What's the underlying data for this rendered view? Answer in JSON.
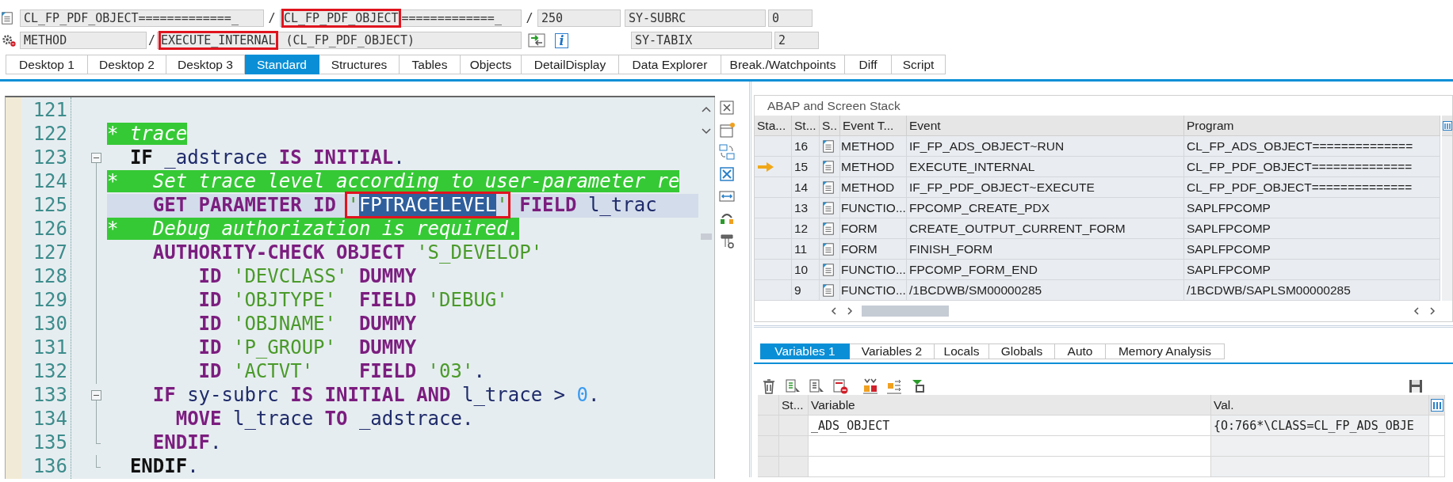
{
  "program_bar": {
    "include": "CL_FP_PDF_OBJECT=============_",
    "separators": [
      "/",
      "/"
    ],
    "main_program": [
      {
        "text": "CL_FP_PDF_OBJECT",
        "marked": true
      },
      {
        "text": "=============_",
        "marked": false
      }
    ],
    "line": "250",
    "sysvar_name": "SY-SUBRC",
    "sysvar_value": "0"
  },
  "event_bar": {
    "event_type": "METHOD",
    "separator": "/",
    "event": [
      {
        "text": "EXECUTE_INTERNAL",
        "marked": true
      },
      {
        "text": " (CL_FP_PDF_OBJECT)",
        "marked": false
      }
    ],
    "info_button": "i",
    "sysvar_name": "SY-TABIX",
    "sysvar_value": "2"
  },
  "tabs": [
    {
      "label": "Desktop 1",
      "selected": false
    },
    {
      "label": "Desktop 2",
      "selected": false
    },
    {
      "label": "Desktop 3",
      "selected": false
    },
    {
      "label": "Standard",
      "selected": true
    },
    {
      "label": "Structures",
      "selected": false
    },
    {
      "label": "Tables",
      "selected": false
    },
    {
      "label": "Objects",
      "selected": false
    },
    {
      "label": "DetailDisplay",
      "selected": false
    },
    {
      "label": "Data Explorer",
      "selected": false
    },
    {
      "label": "Break./Watchpoints",
      "selected": false
    },
    {
      "label": "Diff",
      "selected": false
    },
    {
      "label": "Script",
      "selected": false
    }
  ],
  "code_editor": {
    "lines": [
      {
        "number": "121",
        "current": false,
        "kind": "plain"
      },
      {
        "number": "122",
        "current": false,
        "kind": "plain",
        "tokens": [
          {
            "text": "* trace",
            "kind": "comment"
          }
        ]
      },
      {
        "number": "123",
        "current": false,
        "kind": "fold_start",
        "tokens": [
          {
            "text": "  IF",
            "kind": "block"
          },
          {
            "text": " _adstrace ",
            "kind": "ident"
          },
          {
            "text": "IS INITIAL",
            "kind": "keyword"
          },
          {
            "text": ".",
            "kind": "ident"
          }
        ]
      },
      {
        "number": "124",
        "current": false,
        "kind": "fold_body",
        "tokens": [
          {
            "text": "*   Set trace level according to user-parameter re",
            "kind": "comment"
          }
        ]
      },
      {
        "number": "125",
        "current": true,
        "kind": "fold_body",
        "tokens": [
          {
            "text": "    GET PARAMETER ID ",
            "kind": "keyword"
          },
          {
            "kind": "group",
            "marked": true,
            "tokens": [
              {
                "text": "'",
                "kind": "string",
                "selected": false
              },
              {
                "text": "FPTRACELEVEL",
                "kind": "string",
                "selected": true
              },
              {
                "text": "'",
                "kind": "string",
                "selected": false
              }
            ]
          },
          {
            "text": " FIELD ",
            "kind": "keyword"
          },
          {
            "text": "l_trac",
            "kind": "ident"
          }
        ]
      },
      {
        "number": "126",
        "current": false,
        "kind": "fold_body",
        "tokens": [
          {
            "text": "*   Debug authorization is required.",
            "kind": "comment"
          }
        ]
      },
      {
        "number": "127",
        "current": false,
        "kind": "fold_body",
        "tokens": [
          {
            "text": "    AUTHORITY-CHECK OBJECT ",
            "kind": "keyword"
          },
          {
            "text": "'S_DEVELOP'",
            "kind": "string"
          }
        ]
      },
      {
        "number": "128",
        "current": false,
        "kind": "fold_body",
        "tokens": [
          {
            "text": "        ID ",
            "kind": "keyword"
          },
          {
            "text": "'DEVCLASS' ",
            "kind": "string"
          },
          {
            "text": "DUMMY",
            "kind": "keyword"
          }
        ]
      },
      {
        "number": "129",
        "current": false,
        "kind": "fold_body",
        "tokens": [
          {
            "text": "        ID ",
            "kind": "keyword"
          },
          {
            "text": "'OBJTYPE'  ",
            "kind": "string"
          },
          {
            "text": "FIELD ",
            "kind": "keyword"
          },
          {
            "text": "'DEBUG'",
            "kind": "string"
          }
        ]
      },
      {
        "number": "130",
        "current": false,
        "kind": "fold_body",
        "tokens": [
          {
            "text": "        ID ",
            "kind": "keyword"
          },
          {
            "text": "'OBJNAME'  ",
            "kind": "string"
          },
          {
            "text": "DUMMY",
            "kind": "keyword"
          }
        ]
      },
      {
        "number": "131",
        "current": false,
        "kind": "fold_body",
        "tokens": [
          {
            "text": "        ID ",
            "kind": "keyword"
          },
          {
            "text": "'P_GROUP'  ",
            "kind": "string"
          },
          {
            "text": "DUMMY",
            "kind": "keyword"
          }
        ]
      },
      {
        "number": "132",
        "current": false,
        "kind": "fold_body",
        "tokens": [
          {
            "text": "        ID ",
            "kind": "keyword"
          },
          {
            "text": "'ACTVT'    ",
            "kind": "string"
          },
          {
            "text": "FIELD ",
            "kind": "keyword"
          },
          {
            "text": "'03'",
            "kind": "string"
          },
          {
            "text": ".",
            "kind": "ident"
          }
        ]
      },
      {
        "number": "133",
        "current": false,
        "kind": "fold_start",
        "tokens": [
          {
            "text": "    IF",
            "kind": "keyword"
          },
          {
            "text": " sy-subrc ",
            "kind": "ident"
          },
          {
            "text": "IS INITIAL AND",
            "kind": "keyword"
          },
          {
            "text": " l_trace > ",
            "kind": "ident"
          },
          {
            "text": "0",
            "kind": "number"
          },
          {
            "text": ".",
            "kind": "ident"
          }
        ]
      },
      {
        "number": "134",
        "current": false,
        "kind": "fold_body",
        "tokens": [
          {
            "text": "      MOVE",
            "kind": "keyword"
          },
          {
            "text": " l_trace ",
            "kind": "ident"
          },
          {
            "text": "TO",
            "kind": "keyword"
          },
          {
            "text": " _adstrace.",
            "kind": "ident"
          }
        ]
      },
      {
        "number": "135",
        "current": false,
        "kind": "fold_end",
        "tokens": [
          {
            "text": "    ENDIF",
            "kind": "keyword"
          },
          {
            "text": ".",
            "kind": "ident"
          }
        ]
      },
      {
        "number": "136",
        "current": false,
        "kind": "fold_end",
        "tokens": [
          {
            "text": "  ENDIF",
            "kind": "block"
          },
          {
            "text": ".",
            "kind": "ident"
          }
        ]
      }
    ]
  },
  "stack": {
    "title": "ABAP and Screen Stack",
    "columns": [
      "Sta...",
      "St...",
      "S..",
      "Event T...",
      "Event",
      "Program"
    ],
    "rows": [
      {
        "current": false,
        "number": "16",
        "event_type": "METHOD",
        "event": "IF_FP_ADS_OBJECT~RUN",
        "program": "CL_FP_ADS_OBJECT=============="
      },
      {
        "current": true,
        "number": "15",
        "event_type": "METHOD",
        "event": "EXECUTE_INTERNAL",
        "program": "CL_FP_PDF_OBJECT=============="
      },
      {
        "current": false,
        "number": "14",
        "event_type": "METHOD",
        "event": "IF_FP_PDF_OBJECT~EXECUTE",
        "program": "CL_FP_PDF_OBJECT=============="
      },
      {
        "current": false,
        "number": "13",
        "event_type": "FUNCTIO...",
        "event": "FPCOMP_CREATE_PDX",
        "program": "SAPLFPCOMP"
      },
      {
        "current": false,
        "number": "12",
        "event_type": "FORM",
        "event": "CREATE_OUTPUT_CURRENT_FORM",
        "program": "SAPLFPCOMP"
      },
      {
        "current": false,
        "number": "11",
        "event_type": "FORM",
        "event": "FINISH_FORM",
        "program": "SAPLFPCOMP"
      },
      {
        "current": false,
        "number": "10",
        "event_type": "FUNCTIO...",
        "event": "FPCOMP_FORM_END",
        "program": "SAPLFPCOMP"
      },
      {
        "current": false,
        "number": "9",
        "event_type": "FUNCTIO...",
        "event": "/1BCDWB/SM00000285",
        "program": "/1BCDWB/SAPLSM00000285"
      }
    ]
  },
  "variables": {
    "tabs": [
      {
        "label": "Variables 1",
        "selected": true
      },
      {
        "label": "Variables 2",
        "selected": false
      },
      {
        "label": "Locals",
        "selected": false
      },
      {
        "label": "Globals",
        "selected": false
      },
      {
        "label": "Auto",
        "selected": false
      },
      {
        "label": "Memory Analysis",
        "selected": false
      }
    ],
    "columns": [
      "St...",
      "Variable",
      "Val."
    ],
    "rows": [
      {
        "variable": "_ADS_OBJECT",
        "value": "{O:766*\\CLASS=CL_FP_ADS_OBJE"
      }
    ]
  }
}
